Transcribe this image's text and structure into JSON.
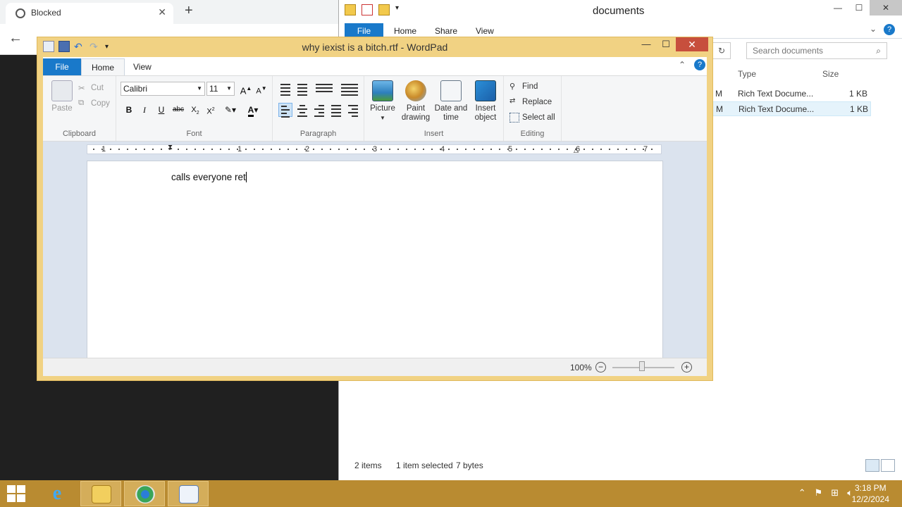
{
  "browser": {
    "tab_title": "Blocked",
    "new_tab_icon": "+",
    "close_icon": "✕",
    "back_icon": "←"
  },
  "explorer": {
    "title": "documents",
    "tabs": [
      "File",
      "Home",
      "Share",
      "View"
    ],
    "search_placeholder": "Search documents",
    "columns": {
      "type": "Type",
      "size": "Size"
    },
    "rows": [
      {
        "type": "Rich Text Docume...",
        "size": "1 KB",
        "date_tail": "M"
      },
      {
        "type": "Rich Text Docume...",
        "size": "1 KB",
        "date_tail": "M"
      }
    ],
    "status": {
      "items": "2 items",
      "selected": "1 item selected",
      "bytes": "7 bytes"
    }
  },
  "wordpad": {
    "title": "why iexist is a bitch.rtf - WordPad",
    "tabs": {
      "file": "File",
      "home": "Home",
      "view": "View"
    },
    "clipboard": {
      "label": "Clipboard",
      "paste": "Paste",
      "cut": "Cut",
      "copy": "Copy"
    },
    "font": {
      "label": "Font",
      "family": "Calibri",
      "size": "11"
    },
    "paragraph": {
      "label": "Paragraph"
    },
    "insert": {
      "label": "Insert",
      "picture": "Picture",
      "paint_1": "Paint",
      "paint_2": "drawing",
      "date_1": "Date and",
      "date_2": "time",
      "obj_1": "Insert",
      "obj_2": "object"
    },
    "editing": {
      "label": "Editing",
      "find": "Find",
      "replace": "Replace",
      "select_all": "Select all"
    },
    "ruler_numbers": [
      "1",
      "1",
      "2",
      "3",
      "4",
      "5",
      "6",
      "7"
    ],
    "document_text": "calls everyone ret",
    "zoom": "100%"
  },
  "taskbar": {
    "time": "3:18 PM",
    "date": "12/2/2024"
  },
  "colors": {
    "wordpad_frame": "#f1d283",
    "close_red": "#c74f3d",
    "file_blue": "#1979ca",
    "taskbar": "#b98b31"
  }
}
